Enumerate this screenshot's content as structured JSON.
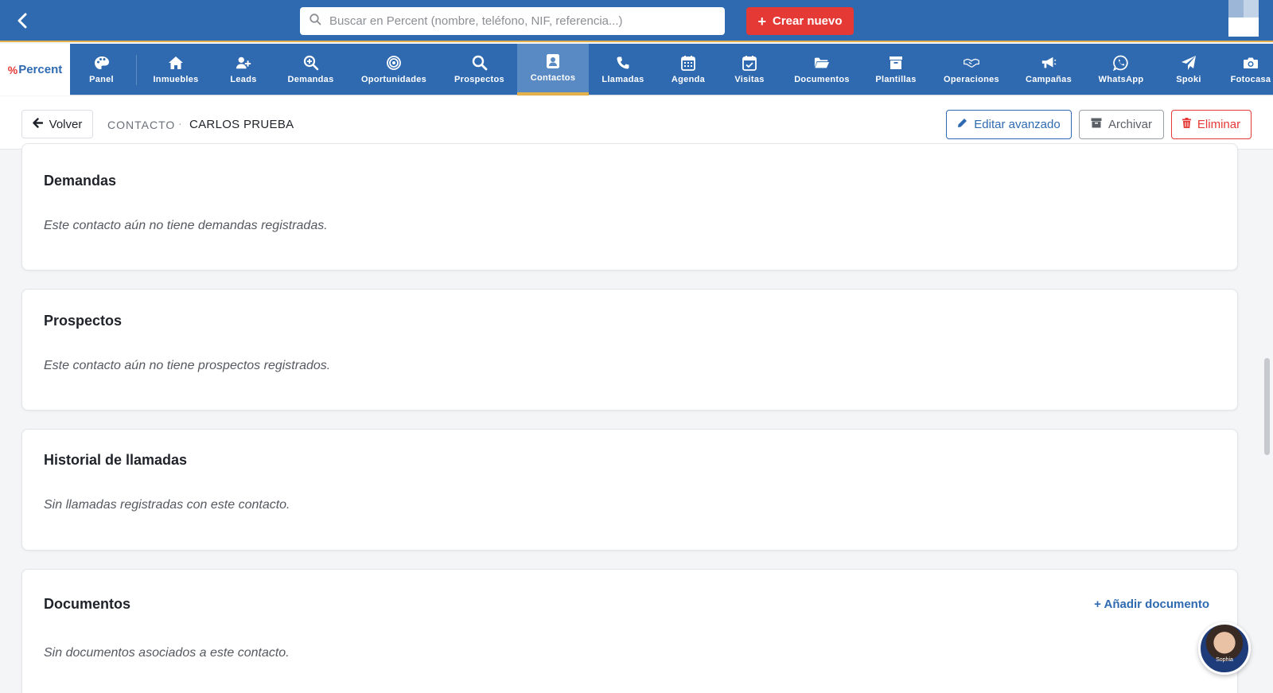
{
  "topbar": {
    "search_placeholder": "Buscar en Percent (nombre, teléfono, NIF, referencia...)",
    "create_label": "Crear nuevo"
  },
  "logo": {
    "text": "Percent"
  },
  "nav": {
    "items": [
      {
        "label": "Panel",
        "icon": "palette-icon"
      },
      {
        "label": "Inmuebles",
        "icon": "home-icon"
      },
      {
        "label": "Leads",
        "icon": "user-plus-icon"
      },
      {
        "label": "Demandas",
        "icon": "search-plus-icon"
      },
      {
        "label": "Oportunidades",
        "icon": "target-icon"
      },
      {
        "label": "Prospectos",
        "icon": "search-icon"
      },
      {
        "label": "Contactos",
        "icon": "contact-card-icon",
        "active": true
      },
      {
        "label": "Llamadas",
        "icon": "phone-icon"
      },
      {
        "label": "Agenda",
        "icon": "calendar-icon"
      },
      {
        "label": "Visitas",
        "icon": "calendar-check-icon"
      },
      {
        "label": "Documentos",
        "icon": "folder-open-icon"
      },
      {
        "label": "Plantillas",
        "icon": "archive-box-icon"
      },
      {
        "label": "Operaciones",
        "icon": "handshake-icon"
      },
      {
        "label": "Campañas",
        "icon": "megaphone-icon"
      },
      {
        "label": "WhatsApp",
        "icon": "whatsapp-icon"
      },
      {
        "label": "Spoki",
        "icon": "paper-plane-icon"
      },
      {
        "label": "Fotocasa",
        "icon": "camera-icon"
      }
    ]
  },
  "breadcrumb": {
    "back_label": "Volver",
    "section": "CONTACTO",
    "separator": "·",
    "name": "CARLOS PRUEBA"
  },
  "actions": {
    "edit_label": "Editar avanzado",
    "archive_label": "Archivar",
    "delete_label": "Eliminar"
  },
  "cards": {
    "demandas": {
      "title": "Demandas",
      "empty": "Este contacto aún no tiene demandas registradas."
    },
    "prospectos": {
      "title": "Prospectos",
      "empty": "Este contacto aún no tiene prospectos registrados."
    },
    "llamadas": {
      "title": "Historial de llamadas",
      "empty": "Sin llamadas registradas con este contacto."
    },
    "documentos": {
      "title": "Documentos",
      "empty": "Sin documentos asociados a este contacto.",
      "add_label": "+ Añadir documento"
    }
  },
  "assistant": {
    "label": "Sophia"
  },
  "colors": {
    "brand_blue": "#2f6ab1",
    "accent_gold": "#e3b04b",
    "danger_red": "#e53935"
  }
}
